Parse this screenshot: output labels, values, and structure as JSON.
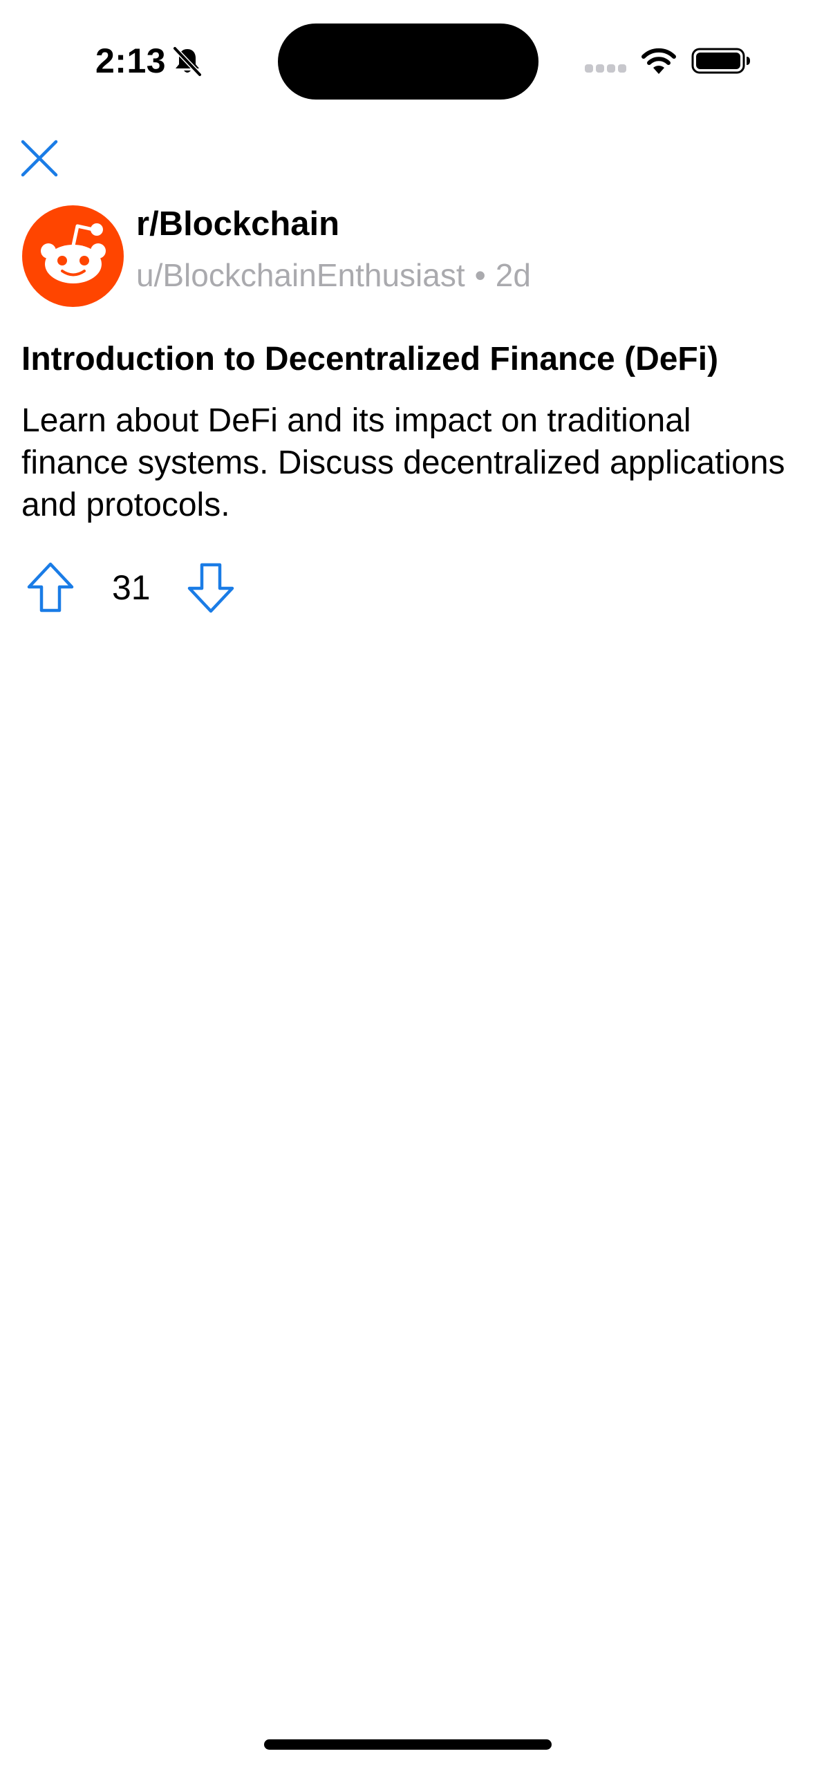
{
  "status_bar": {
    "time": "2:13",
    "icons": [
      "bell-slash-icon",
      "signal-icon",
      "wifi-icon",
      "battery-icon"
    ]
  },
  "toolbar": {
    "close_icon": "close-icon"
  },
  "post": {
    "subreddit": "r/Blockchain",
    "author": "u/BlockchainEnthusiast",
    "separator": "•",
    "age": "2d",
    "title": "Introduction to Decentralized Finance (DeFi)",
    "body": "Learn about DeFi and its impact on traditional finance systems. Discuss decentralized applications and protocols.",
    "score": "31"
  },
  "colors": {
    "accent": "#1A7CE6",
    "avatar_bg": "#FF4500",
    "meta_text": "#AAAAAE"
  }
}
